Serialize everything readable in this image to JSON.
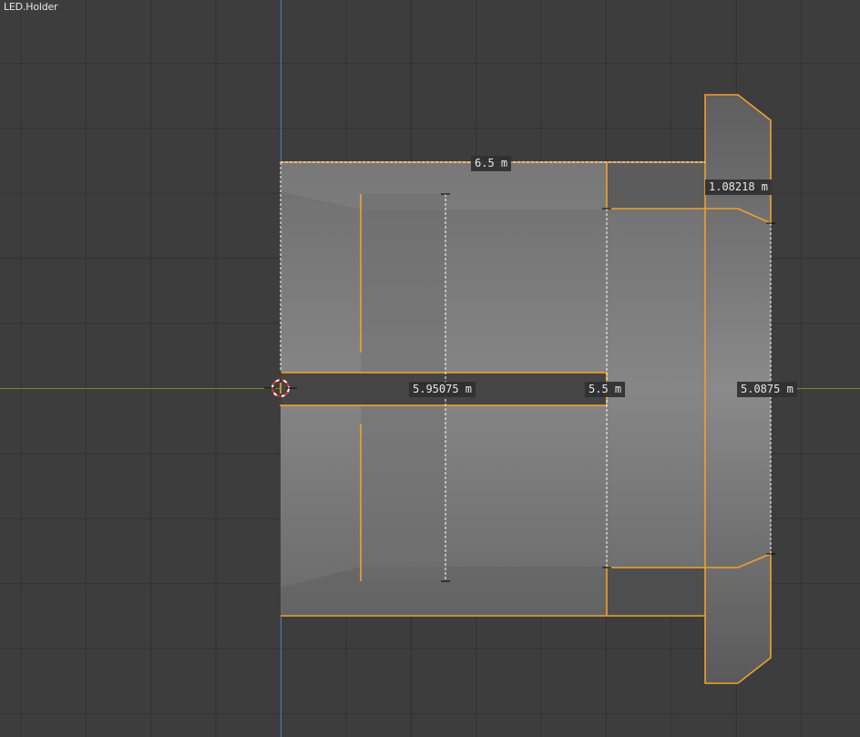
{
  "viewport": {
    "object_name": "LED.Holder",
    "colors": {
      "background": "#3d3d3d",
      "x_axis": "#6b8e23",
      "z_axis": "#4a7dbf",
      "selection": "#f0a030"
    }
  },
  "measurements": {
    "width_top": "6.5 m",
    "flange_height": "1.08218 m",
    "inner_length": "5.95075 m",
    "middle_length": "5.5 m",
    "outer_length": "5.0875 m"
  }
}
